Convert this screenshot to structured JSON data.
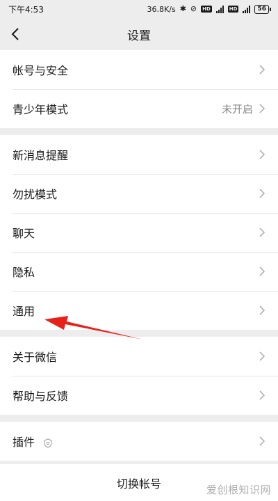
{
  "status_bar": {
    "time": "下午4:53",
    "speed": "36.8K/s",
    "hd_label": "HD",
    "network_label": "4G",
    "battery": "56"
  },
  "nav": {
    "title": "设置",
    "back_icon": "chevron-left-icon"
  },
  "groups": [
    [
      {
        "label": "帐号与安全",
        "value": ""
      },
      {
        "label": "青少年模式",
        "value": "未开启"
      }
    ],
    [
      {
        "label": "新消息提醒",
        "value": ""
      },
      {
        "label": "勿扰模式",
        "value": ""
      },
      {
        "label": "聊天",
        "value": ""
      },
      {
        "label": "隐私",
        "value": ""
      },
      {
        "label": "通用",
        "value": ""
      }
    ],
    [
      {
        "label": "关于微信",
        "value": ""
      },
      {
        "label": "帮助与反馈",
        "value": ""
      }
    ],
    [
      {
        "label": "插件",
        "value": ""
      }
    ]
  ],
  "footer": {
    "switch_account": "切换帐号"
  },
  "watermark": "爱创根知识网",
  "colors": {
    "background": "#ededed",
    "row_background": "#ffffff",
    "annotation_arrow": "#e8201a"
  }
}
